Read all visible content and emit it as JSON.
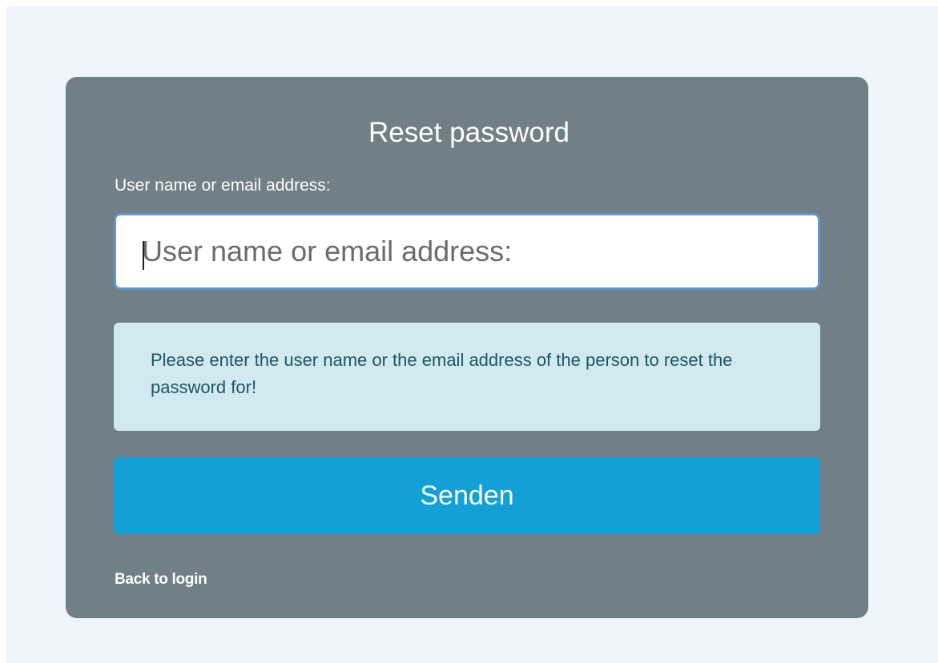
{
  "form": {
    "title": "Reset password",
    "field_label": "User name or email address:",
    "input_value": "",
    "input_placeholder": "User name or email address:",
    "info_message": "Please enter the user name or the email address of the person to reset the password for!",
    "submit_label": "Senden",
    "back_link_label": "Back to login"
  },
  "colors": {
    "page_background": "#eef5fc",
    "card_background": "#717f86",
    "info_background": "#d1eaef",
    "info_text": "#1d5566",
    "button_background": "#12a0d7",
    "input_focus_border": "#5f95d3"
  }
}
